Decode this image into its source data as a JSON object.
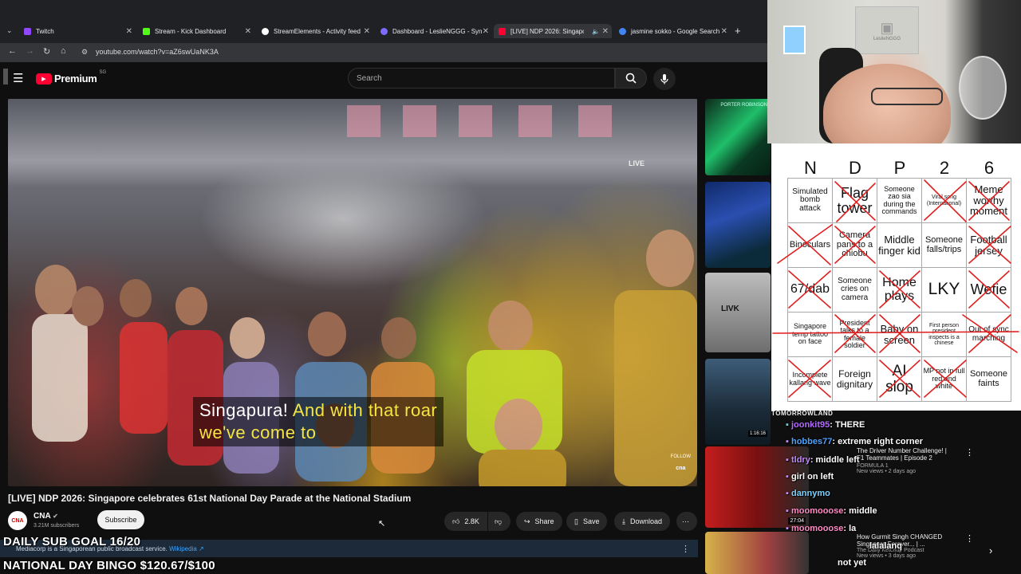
{
  "browser": {
    "tabs": [
      {
        "label": "Twitch",
        "color": "#9146ff"
      },
      {
        "label": "Stream - Kick Dashboard",
        "color": "#53fc18"
      },
      {
        "label": "StreamElements - Activity feed",
        "color": "#ffffff"
      },
      {
        "label": "Dashboard - LeslieNGGG - Syn",
        "color": "#7b6cff"
      },
      {
        "label": "[LIVE] NDP 2026: Singapore",
        "color": "#ff0033"
      },
      {
        "label": "jasmine sokko - Google Search",
        "color": "#4285f4"
      }
    ],
    "new_tab": "+",
    "url": "youtube.com/watch?v=aZ6swUaNK3A"
  },
  "youtube": {
    "logo": "Premium",
    "logo_sup": "SG",
    "search_placeholder": "Search"
  },
  "video": {
    "subtitle_white": "Singapura!",
    "subtitle_yellow_1": "And with that roar",
    "subtitle_yellow_2": "we've come to",
    "live_tag": "LIVE",
    "follow_tag": "FOLLOW",
    "cna_tag": "cna",
    "title": "[LIVE] NDP 2026: Singapore celebrates 61st National Day Parade at the National Stadium"
  },
  "channel": {
    "avatar": "CNA",
    "name": "CNA",
    "subscribers": "3.21M subscribers",
    "subscribe_label": "Subscribe"
  },
  "actions": {
    "likes": "2.8K",
    "share": "Share",
    "save": "Save",
    "download": "Download"
  },
  "info_bar": {
    "text": "Mediacorp is a Singaporean public broadcast service.",
    "link": "Wikipedia"
  },
  "overlays": {
    "sub_goal": "DAILY SUB GOAL 16/20",
    "bingo_goal": "NATIONAL DAY BINGO $120.67/$100",
    "tomorrowland": "TOMORROWLAND"
  },
  "sidebar": {
    "thumb1_text": "PORTER ROBINSON",
    "video1_title_1": "The Driver Number Challenge! |",
    "video1_title_2": "F1 Teammates | Episode 2",
    "video1_channel": "FORMULA 1",
    "video1_meta": "New views • 2 days ago",
    "video1_duration": "27:04",
    "video2_title_1": "How Gurmit Singh CHANGED",
    "video2_title_2": "Singapore Forever... | ...",
    "video2_channel": "The Daily Ketchup Podcast",
    "video2_meta": "New views • 3 days ago",
    "dj_duration": "1:16:16"
  },
  "bingo": {
    "headers": [
      "N",
      "D",
      "P",
      "2",
      "6"
    ],
    "cells": [
      [
        "Simulated bomb attack",
        "Flag tower",
        "Someone zao sia during the commands",
        "Viral song (International)",
        "Meme worthy moment"
      ],
      [
        "Binoculars",
        "Camera pans to a chiobu",
        "Middle finger kid",
        "Someone falls/trips",
        "Football jersey"
      ],
      [
        "67/dab",
        "Someone cries on camera",
        "Home plays",
        "LKY",
        "Wefie"
      ],
      [
        "Singapore temp tattoo on face",
        "President talks to a female soldier",
        "Baby on screen",
        "First person president inspects is a chinese",
        "Out of sync marching"
      ],
      [
        "Incomplete kallang wave",
        "Foreign dignitary",
        "AI slop",
        "MP not in full red and white",
        "Someone faints"
      ]
    ]
  },
  "chat": [
    {
      "user": "joonkit95",
      "msg": "THERE",
      "color": "#b36bff"
    },
    {
      "user": "hobbes77",
      "msg": "extreme right corner",
      "color": "#4da3ff"
    },
    {
      "user": "tldry",
      "msg": "middle left",
      "color": "#c58af9"
    },
    {
      "user": "",
      "msg": "girl on left",
      "color": "#ffffff"
    },
    {
      "user": "dannymo",
      "msg": "",
      "color": "#7fd1ff"
    },
    {
      "user": "moomooose",
      "msg": "middle",
      "color": "#ff8ac5"
    },
    {
      "user": "moomooose",
      "msg": "la",
      "color": "#ff8ac5"
    },
    {
      "user": "",
      "msg": "lalalanq",
      "color": "#ffffff"
    },
    {
      "user": "",
      "msg": "not yet",
      "color": "#ffffff"
    }
  ],
  "webcam": {
    "sign": "LeslieNGGG"
  }
}
